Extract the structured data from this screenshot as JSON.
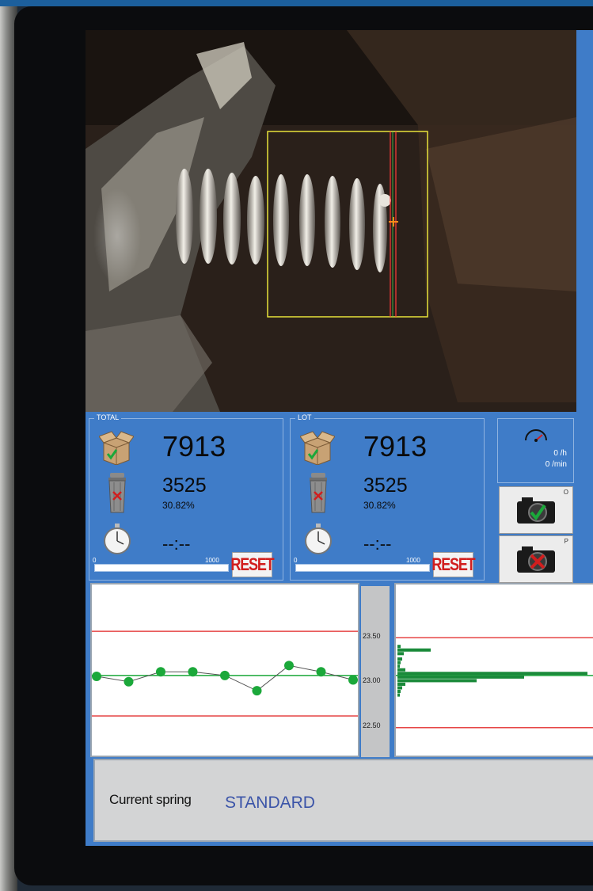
{
  "panels": {
    "total": {
      "legend": "TOTAL",
      "good_count": "7913",
      "reject_count": "3525",
      "reject_pct": "30.82%",
      "time": "--:--",
      "progress": {
        "min": "0",
        "max": "1000",
        "value_fraction": 0.0
      },
      "reset_label": "RESET"
    },
    "lot": {
      "legend": "LOT",
      "good_count": "7913",
      "reject_count": "3525",
      "reject_pct": "30.82%",
      "time": "--:--",
      "progress": {
        "min": "0",
        "max": "1000",
        "value_fraction": 0.0
      },
      "reset_label": "RESET"
    }
  },
  "speed": {
    "per_hour": "0 /h",
    "per_min": "0 /min"
  },
  "camera_buttons": {
    "ok_tag": "O",
    "reject_tag": "P"
  },
  "chart_data": [
    {
      "type": "line",
      "x": [
        1,
        2,
        3,
        4,
        5,
        6,
        7,
        8,
        9
      ],
      "series": [
        {
          "values": [
            23.03,
            22.97,
            23.08,
            23.08,
            23.04,
            22.87,
            23.15,
            23.08,
            22.99
          ]
        }
      ],
      "y_ticks": [
        "23.50",
        "23.00",
        "22.50"
      ],
      "ylim": [
        22.15,
        24.05
      ],
      "limit_lines": [
        23.53,
        22.59
      ],
      "center_line": 23.04,
      "grid": false
    },
    {
      "type": "bar",
      "orientation": "horizontal",
      "bins": [
        23.36,
        23.32,
        23.28,
        23.22,
        23.18,
        23.14,
        23.1,
        23.06,
        23.02,
        22.98,
        22.94,
        22.9,
        22.86,
        22.82
      ],
      "values": [
        4,
        42,
        8,
        6,
        4,
        3,
        10,
        240,
        160,
        100,
        10,
        6,
        4,
        3
      ],
      "limit_lines": [
        23.46,
        22.46
      ],
      "center_line": 23.04
    }
  ],
  "footer": {
    "label": "Current spring",
    "value": "STANDARD"
  },
  "colors": {
    "screen_blue": "#3f7cc8",
    "reset_red": "#d11e1e",
    "good_green": "#1ba83a",
    "limit_red": "#e64545"
  }
}
